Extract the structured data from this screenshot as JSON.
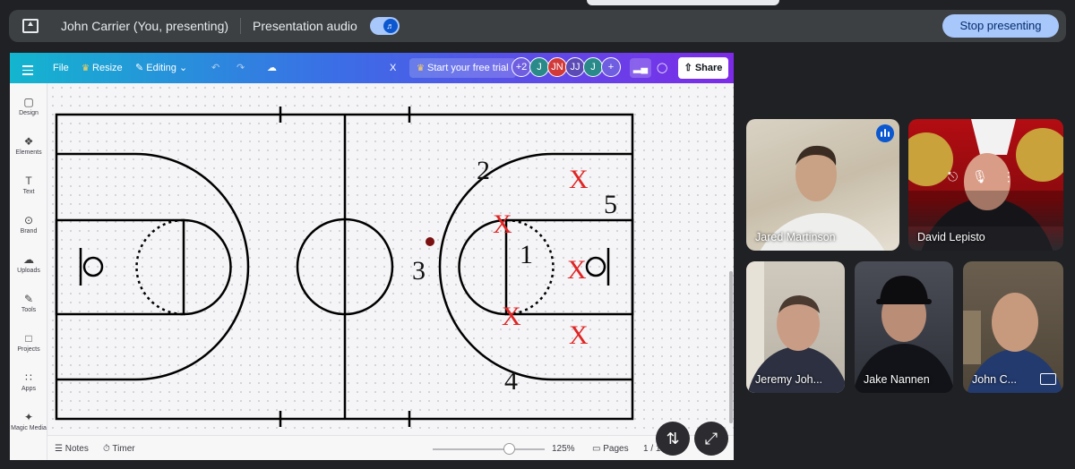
{
  "meet": {
    "presenter_label": "John Carrier (You, presenting)",
    "presentation_audio_label": "Presentation audio",
    "stop_presenting_label": "Stop presenting"
  },
  "canva": {
    "menu": {
      "file_label": "File",
      "resize_label": "Resize",
      "editing_label": "Editing",
      "close_x": "X",
      "trial_label": "Start your free trial",
      "share_label": "Share"
    },
    "collaborators": [
      {
        "initials": "+2",
        "color": "#6f5fe0"
      },
      {
        "initials": "J",
        "color": "#2a8a8a"
      },
      {
        "initials": "JN",
        "color": "#d23a3a"
      },
      {
        "initials": "JJ",
        "color": "#5a4bb5"
      },
      {
        "initials": "J",
        "color": "#2a8a8a"
      },
      {
        "initials": "+",
        "color": "#6f5fe0"
      }
    ],
    "sidebar": [
      "Design",
      "Elements",
      "Text",
      "Brand",
      "Uploads",
      "Tools",
      "Projects",
      "Apps",
      "Magic Media"
    ],
    "sidebar_icons": [
      "layout-icon",
      "elements-icon",
      "text-icon",
      "brand-icon",
      "uploads-icon",
      "tools-icon",
      "projects-icon",
      "apps-icon",
      "magic-media-icon"
    ],
    "bottom": {
      "notes_label": "Notes",
      "timer_label": "Timer",
      "zoom_label": "125%",
      "pages_label": "Pages",
      "page_count": "1 / 1",
      "zoom_fraction": 0.68
    },
    "diagram": {
      "numbers": [
        "1",
        "2",
        "3",
        "4",
        "5"
      ],
      "defender_mark": "X",
      "defender_color": "#e02424"
    }
  },
  "participants": [
    {
      "name": "Jared Martinson",
      "speaking": true
    },
    {
      "name": "David Lepisto",
      "speaking": false
    },
    {
      "name": "Jeremy Joh...",
      "speaking": false
    },
    {
      "name": "Jake Nannen",
      "speaking": false
    },
    {
      "name": "John C...",
      "speaking": false
    }
  ]
}
